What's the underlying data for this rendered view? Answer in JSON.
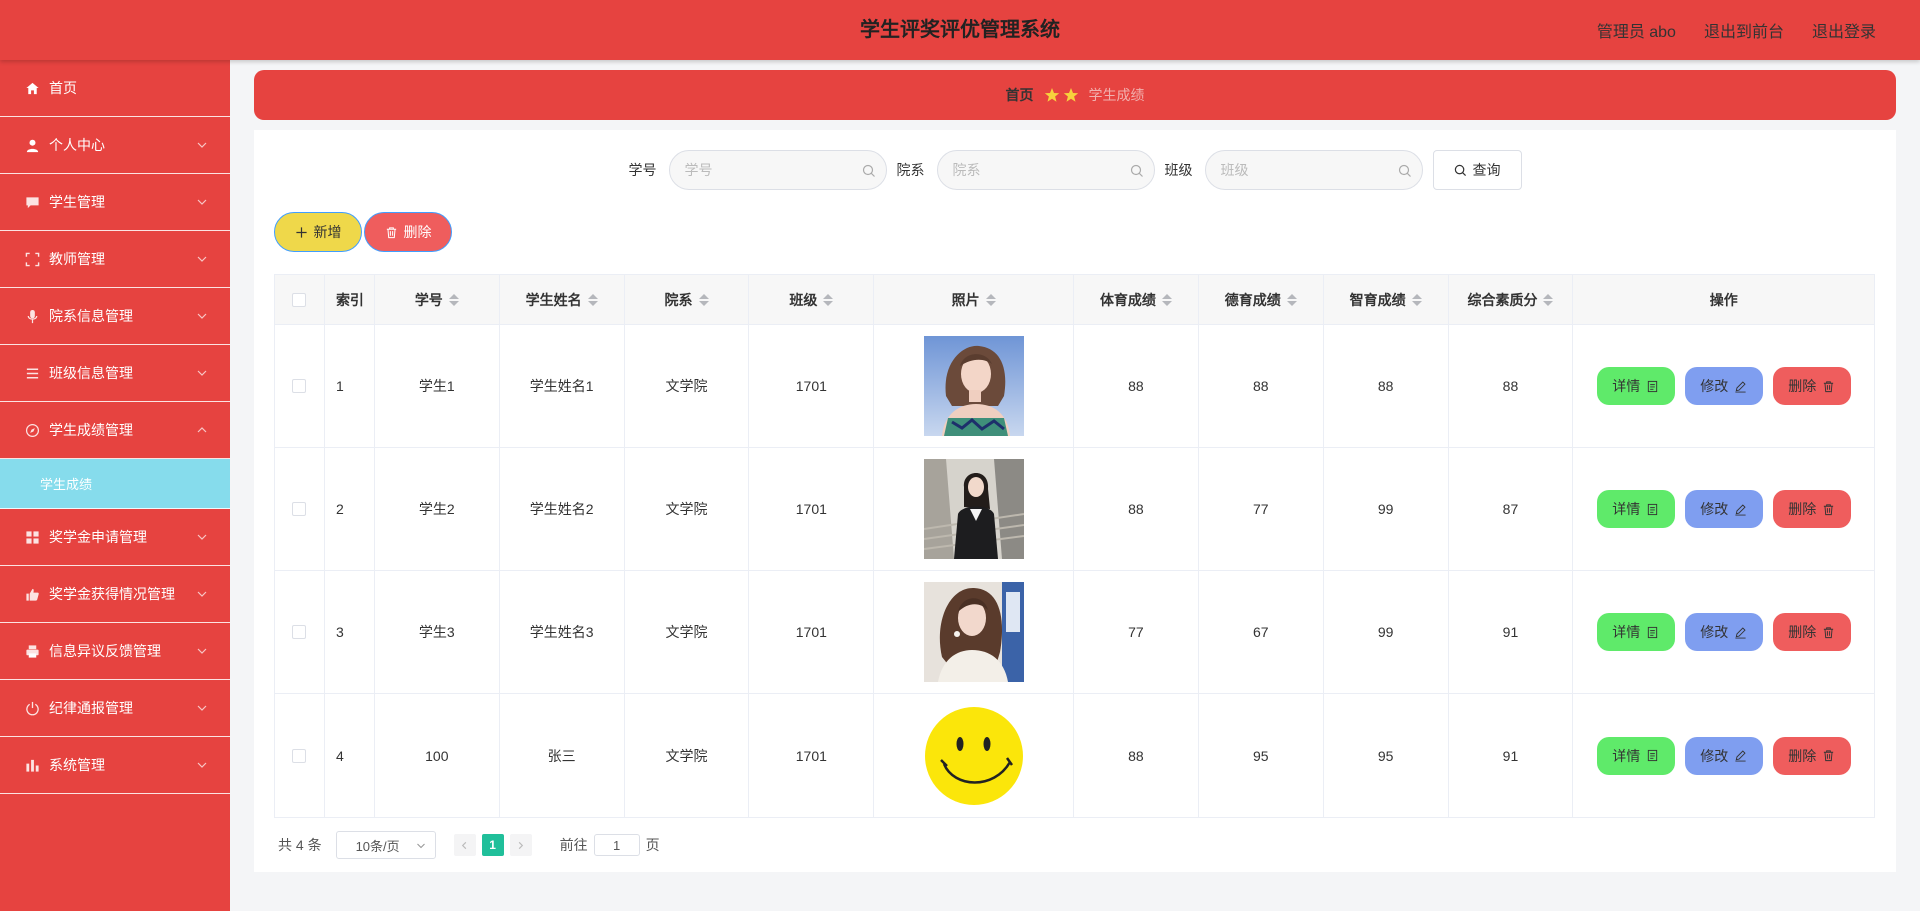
{
  "app": {
    "title": "学生评奖评优管理系统",
    "user": "管理员 abo",
    "to_front": "退出到前台",
    "logout": "退出登录"
  },
  "sidebar": {
    "items": [
      {
        "label": "首页",
        "icon": "home-icon"
      },
      {
        "label": "个人中心",
        "icon": "user-icon"
      },
      {
        "label": "学生管理",
        "icon": "chat-icon"
      },
      {
        "label": "教师管理",
        "icon": "fullscreen-icon"
      },
      {
        "label": "院系信息管理",
        "icon": "microphone-icon"
      },
      {
        "label": "班级信息管理",
        "icon": "list-icon"
      },
      {
        "label": "学生成绩管理",
        "icon": "compass-icon"
      },
      {
        "label": "奖学金申请管理",
        "icon": "grid-icon"
      },
      {
        "label": "奖学金获得情况管理",
        "icon": "thumb-icon"
      },
      {
        "label": "信息异议反馈管理",
        "icon": "printer-icon"
      },
      {
        "label": "纪律通报管理",
        "icon": "power-icon"
      },
      {
        "label": "系统管理",
        "icon": "chart-icon"
      }
    ],
    "active_sub": "学生成绩"
  },
  "breadcrumb": {
    "home": "首页",
    "current": "学生成绩"
  },
  "search": {
    "fields": [
      {
        "label": "学号",
        "placeholder": "学号"
      },
      {
        "label": "院系",
        "placeholder": "院系"
      },
      {
        "label": "班级",
        "placeholder": "班级"
      }
    ],
    "query_label": "查询"
  },
  "actions": {
    "add_label": "新增",
    "delete_label": "删除"
  },
  "table": {
    "headers": [
      "索引",
      "学号",
      "学生姓名",
      "院系",
      "班级",
      "照片",
      "体育成绩",
      "德育成绩",
      "智育成绩",
      "综合素质分",
      "操作"
    ],
    "rows": [
      {
        "index": "1",
        "xuehao": "学生1",
        "name": "学生姓名1",
        "dept": "文学院",
        "cls": "1701",
        "photo": "portrait-1",
        "pe": "88",
        "moral": "88",
        "intel": "88",
        "total": "88"
      },
      {
        "index": "2",
        "xuehao": "学生2",
        "name": "学生姓名2",
        "dept": "文学院",
        "cls": "1701",
        "photo": "portrait-2",
        "pe": "88",
        "moral": "77",
        "intel": "99",
        "total": "87"
      },
      {
        "index": "3",
        "xuehao": "学生3",
        "name": "学生姓名3",
        "dept": "文学院",
        "cls": "1701",
        "photo": "portrait-3",
        "pe": "77",
        "moral": "67",
        "intel": "99",
        "total": "91"
      },
      {
        "index": "4",
        "xuehao": "100",
        "name": "张三",
        "dept": "文学院",
        "cls": "1701",
        "photo": "smiley",
        "pe": "88",
        "moral": "95",
        "intel": "95",
        "total": "91"
      }
    ],
    "ops": {
      "detail": "详情",
      "edit": "修改",
      "delete": "删除"
    }
  },
  "pagination": {
    "total": "共 4 条",
    "page_size": "10条/页",
    "current_page": "1",
    "goto_prefix": "前往",
    "goto_value": "1",
    "goto_suffix": "页"
  },
  "colors": {
    "primary": "#e64340",
    "submenu_active": "#86dcec",
    "add": "#efd84a",
    "delete": "#ef5d5d",
    "detail": "#5fea6a",
    "edit": "#7f9ef0",
    "page_active": "#20bf9a"
  }
}
